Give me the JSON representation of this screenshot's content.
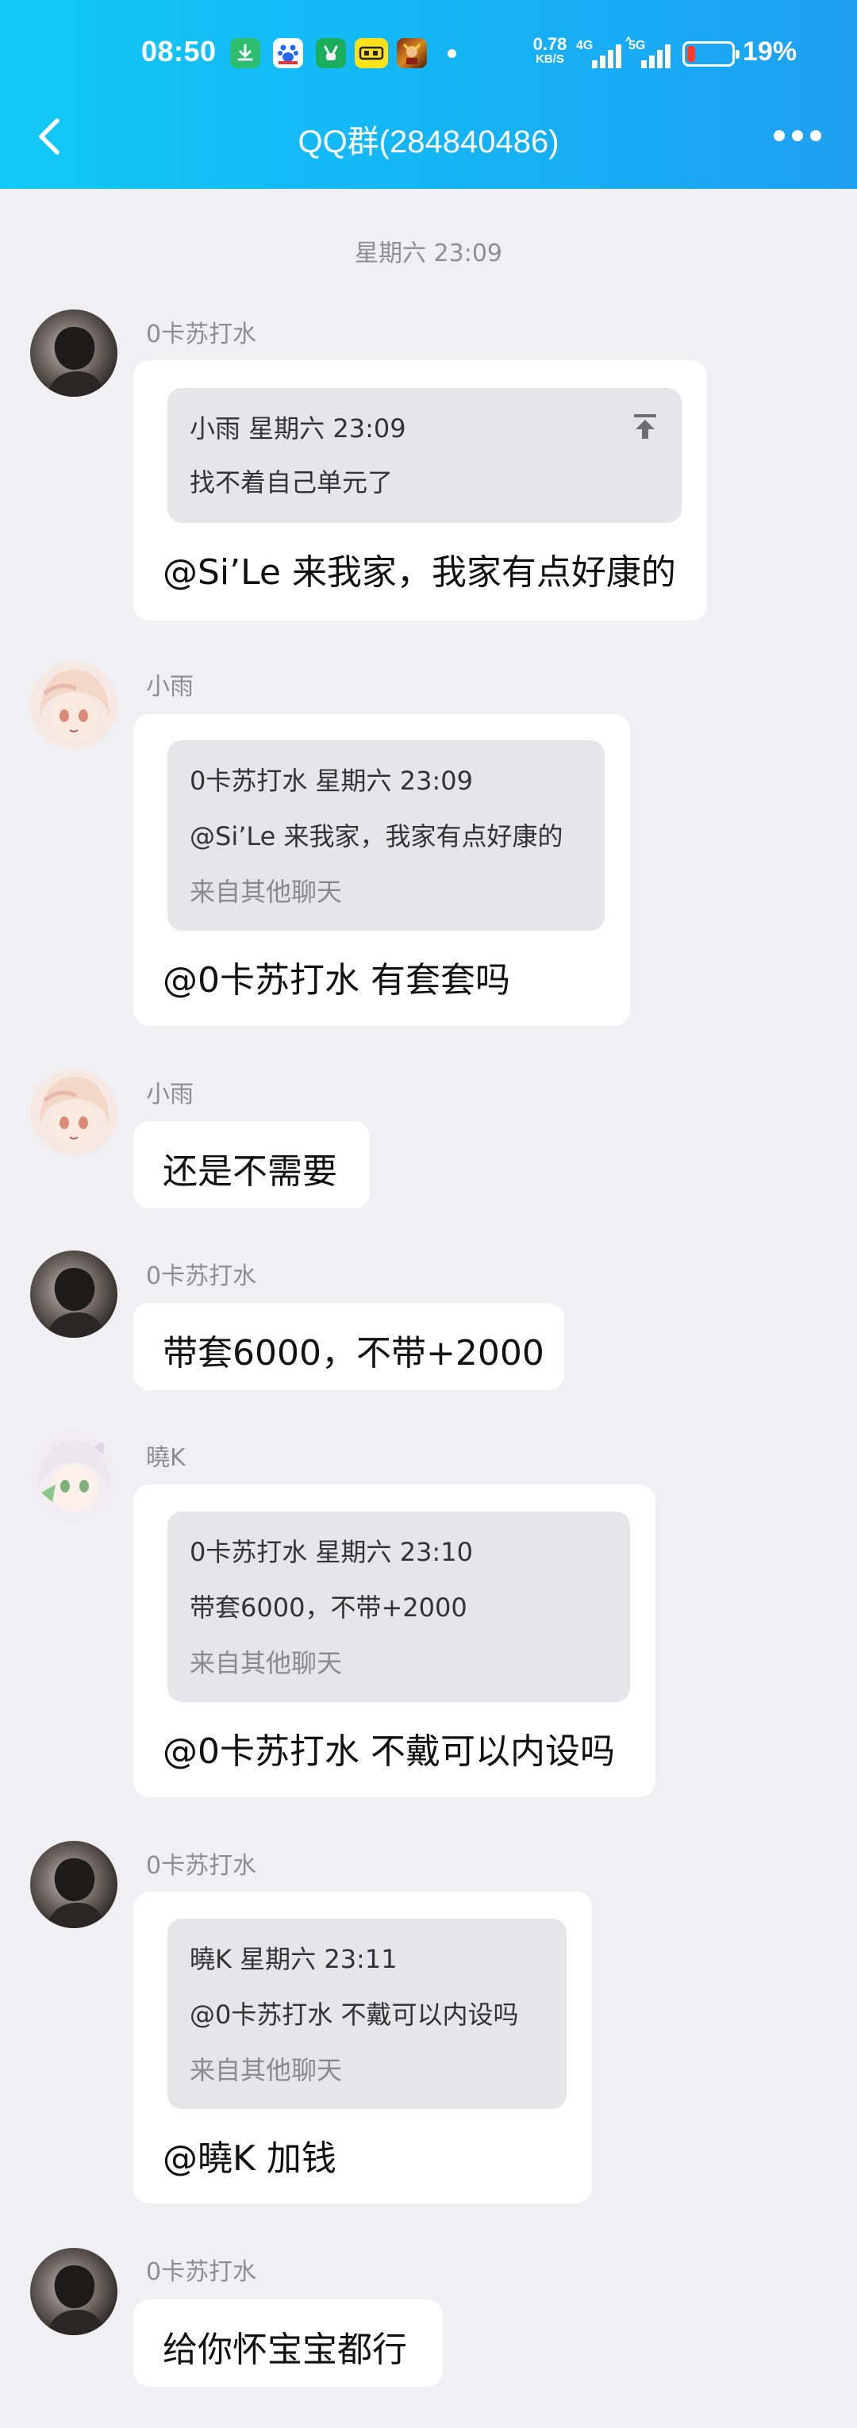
{
  "status_bar": {
    "time": "08:50",
    "network_speed_value": "0.78",
    "network_speed_unit": "KB/S",
    "signal1_label": "4G",
    "signal2_label": "5G",
    "battery_level": 0.19,
    "battery_text": "19%",
    "notification_icons": [
      "download-icon",
      "baidu-icon",
      "game-icon",
      "app-icon",
      "game-avatar-icon"
    ]
  },
  "nav": {
    "title": "QQ群(284840486)"
  },
  "chat": {
    "timestamp": "星期六 23:09",
    "messages": [
      {
        "sender": "0卡苏打水",
        "quote": {
          "header": "小雨 星期六 23:09",
          "text": "找不着自己单元了",
          "source": ""
        },
        "text": "@Si’Le 来我家，我家有点好康的"
      },
      {
        "sender": "小雨",
        "quote": {
          "header": "0卡苏打水 星期六 23:09",
          "text": "@Si’Le 来我家，我家有点好康的",
          "source": "来自其他聊天"
        },
        "text": "@0卡苏打水 有套套吗"
      },
      {
        "sender": "小雨",
        "text": "还是不需要"
      },
      {
        "sender": "0卡苏打水",
        "text": "带套6000，不带+2000"
      },
      {
        "sender": "曉K",
        "quote": {
          "header": "0卡苏打水 星期六 23:10",
          "text": "带套6000，不带+2000",
          "source": "来自其他聊天"
        },
        "text": "@0卡苏打水 不戴可以内设吗"
      },
      {
        "sender": "0卡苏打水",
        "quote": {
          "header": "曉K 星期六 23:11",
          "text": "@0卡苏打水 不戴可以内设吗",
          "source": "来自其他聊天"
        },
        "text": "@曉K 加钱"
      },
      {
        "sender": "0卡苏打水",
        "text": "给你怀宝宝都行"
      }
    ]
  },
  "colors": {
    "header_start": "#12c9f7",
    "header_end": "#1ea0f2",
    "background": "#f0f0f2",
    "bubble": "#ffffff",
    "quote_bg": "#e6e6ea",
    "battery_low": "#ff3b30"
  }
}
